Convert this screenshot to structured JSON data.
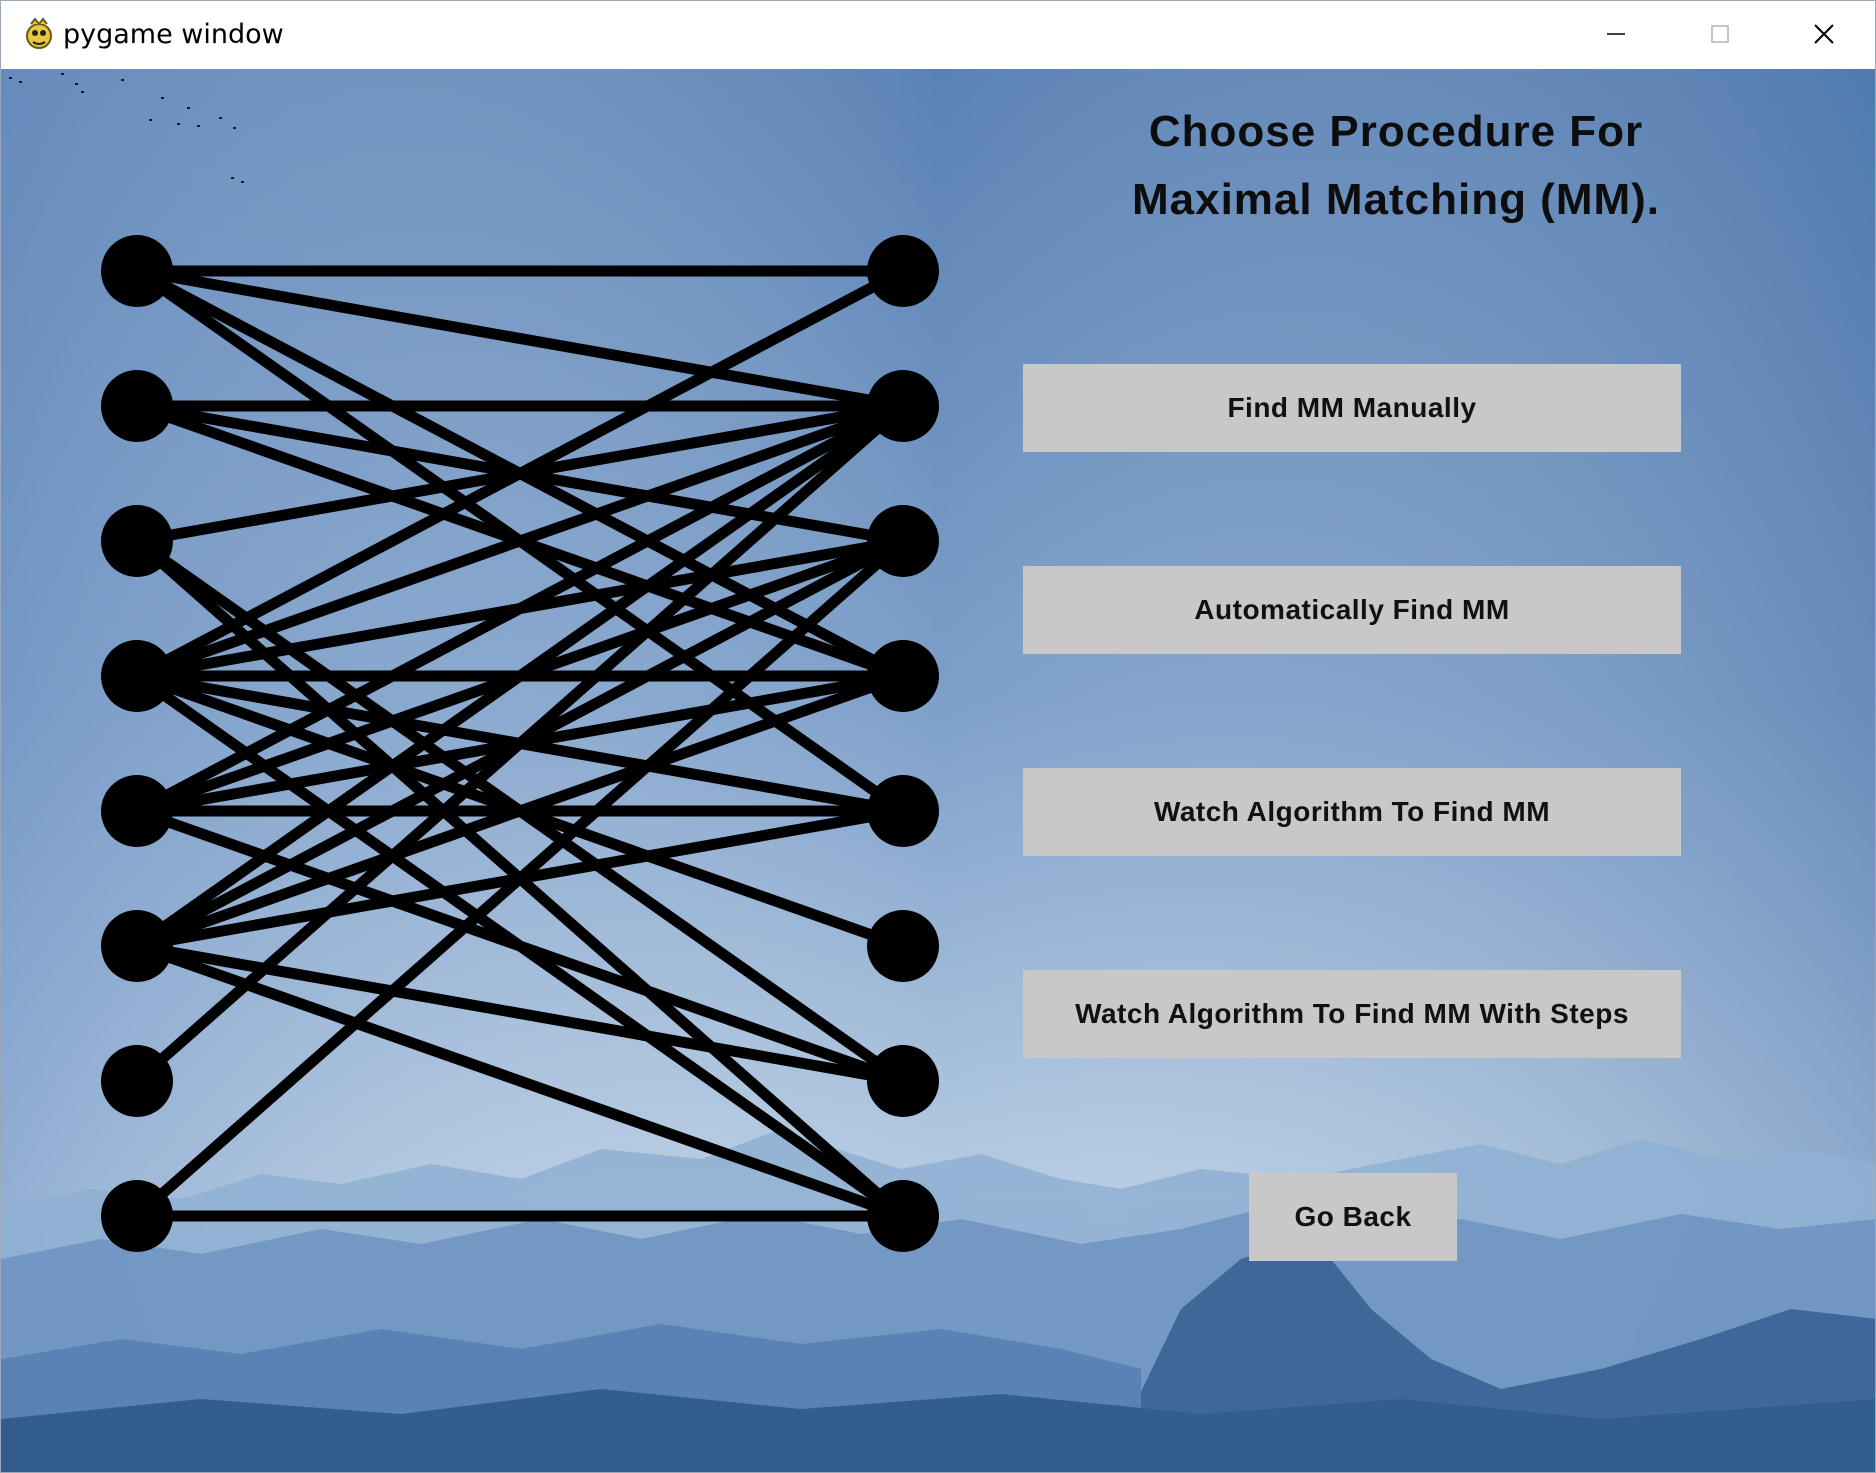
{
  "window": {
    "title": "pygame window",
    "controls": [
      "minimize",
      "maximize",
      "close"
    ]
  },
  "heading": {
    "line1": "Choose Procedure For",
    "line2": "Maximal Matching (MM)."
  },
  "buttons": {
    "find_manually": "Find MM Manually",
    "auto_find": "Automatically Find MM",
    "watch_algorithm": "Watch Algorithm To Find MM",
    "watch_algorithm_steps": "Watch Algorithm To Find MM With Steps",
    "go_back": "Go Back"
  },
  "graph": {
    "left_vertices": 8,
    "right_vertices": 8,
    "edges": [
      [
        1,
        1
      ],
      [
        1,
        2
      ],
      [
        1,
        4
      ],
      [
        1,
        5
      ],
      [
        2,
        2
      ],
      [
        2,
        3
      ],
      [
        2,
        4
      ],
      [
        3,
        2
      ],
      [
        3,
        7
      ],
      [
        3,
        8
      ],
      [
        4,
        1
      ],
      [
        4,
        2
      ],
      [
        4,
        3
      ],
      [
        4,
        4
      ],
      [
        4,
        5
      ],
      [
        4,
        6
      ],
      [
        4,
        8
      ],
      [
        5,
        2
      ],
      [
        5,
        3
      ],
      [
        5,
        4
      ],
      [
        5,
        5
      ],
      [
        5,
        7
      ],
      [
        6,
        2
      ],
      [
        6,
        3
      ],
      [
        6,
        4
      ],
      [
        6,
        5
      ],
      [
        6,
        7
      ],
      [
        6,
        8
      ],
      [
        7,
        2
      ],
      [
        8,
        3
      ],
      [
        8,
        8
      ]
    ],
    "vertex_color": "#000000",
    "edge_color": "#000000"
  },
  "colors": {
    "button_bg": "#c8c8c8",
    "sky_top": "#5f86b8",
    "sky_bottom": "#b9cfe3"
  }
}
